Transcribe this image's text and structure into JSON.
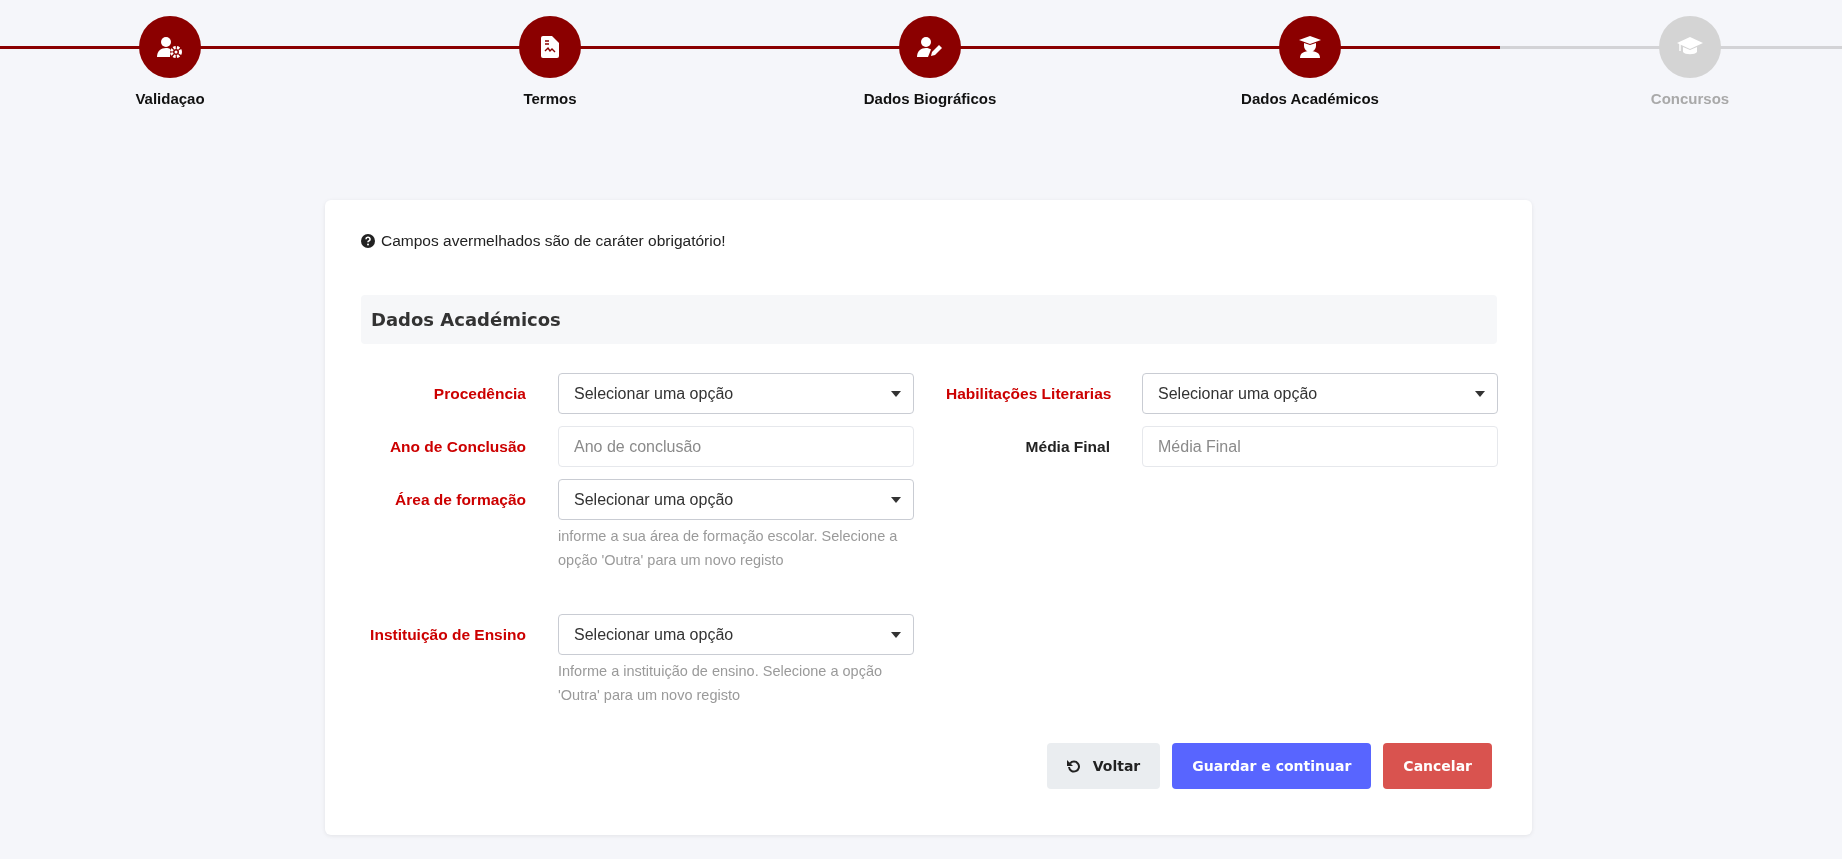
{
  "steps": [
    {
      "label": "Validaçao",
      "kind": "validation",
      "completed": true
    },
    {
      "label": "Termos",
      "kind": "terms",
      "completed": true
    },
    {
      "label": "Dados Biográficos",
      "kind": "biography",
      "completed": true
    },
    {
      "label": "Dados Académicos",
      "kind": "academic",
      "completed": true
    },
    {
      "label": "Concursos",
      "kind": "contests",
      "completed": false
    }
  ],
  "notice": "Campos avermelhados são de caráter obrigatório!",
  "section_title": "Dados Académicos",
  "rows": [
    [
      {
        "label": "Procedência",
        "required": true,
        "kind": "select",
        "value": "Selecionar uma opção"
      },
      {
        "label": "Habilitações Literarias",
        "required": true,
        "kind": "select",
        "value": "Selecionar uma opção"
      }
    ],
    [
      {
        "label": "Ano de Conclusão",
        "required": true,
        "kind": "text",
        "placeholder": "Ano de conclusão"
      },
      {
        "label": "Média Final",
        "required": false,
        "kind": "text",
        "placeholder": "Média Final"
      }
    ],
    [
      {
        "label": "Área de formação",
        "required": true,
        "kind": "select",
        "value": "Selecionar uma opção",
        "help": "informe a sua área de formação escolar. Selecione a opção 'Outra' para um novo registo"
      }
    ],
    [
      {
        "label": "Instituição de Ensino",
        "required": true,
        "kind": "select",
        "value": "Selecionar uma opção",
        "help": "Informe a instituição de ensino. Selecione a opção 'Outra' para um novo registo"
      }
    ]
  ],
  "buttons": [
    {
      "label": "Voltar",
      "kind": "back"
    },
    {
      "label": "Guardar e continuar",
      "kind": "primary"
    },
    {
      "label": "Cancelar",
      "kind": "danger"
    }
  ]
}
